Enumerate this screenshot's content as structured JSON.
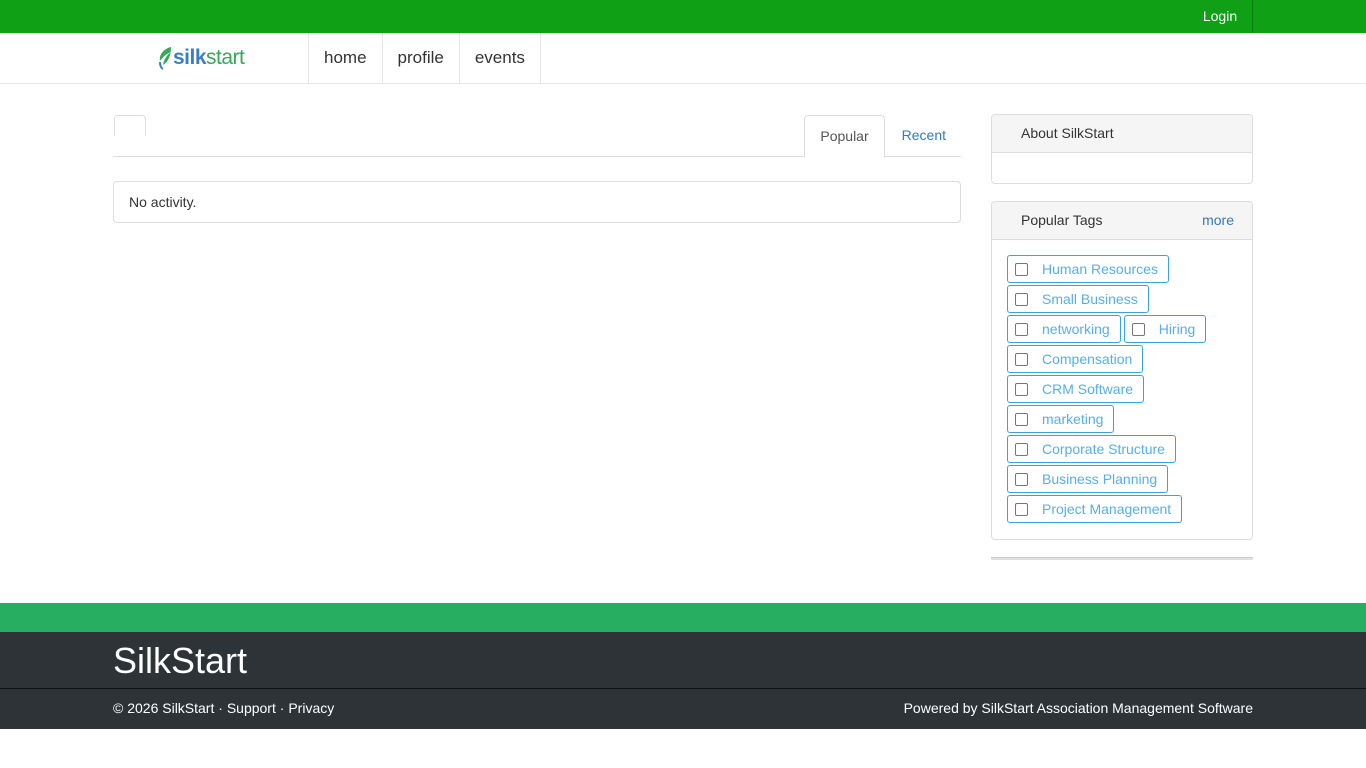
{
  "topbar": {
    "login_label": "Login"
  },
  "logo": {
    "silk": "silk",
    "start": "start"
  },
  "nav": {
    "items": [
      {
        "label": "home"
      },
      {
        "label": "profile"
      },
      {
        "label": "events"
      }
    ]
  },
  "main": {
    "tabs": [
      {
        "label": "Popular",
        "active": true
      },
      {
        "label": "Recent",
        "active": false
      }
    ],
    "empty_message": "No activity."
  },
  "sidebar": {
    "about_title": "About SilkStart",
    "tags_title": "Popular Tags",
    "more_label": "more",
    "tag_rows": [
      [
        "Human Resources"
      ],
      [
        "Small Business"
      ],
      [
        "networking",
        "Hiring"
      ],
      [
        "Compensation"
      ],
      [
        "CRM Software"
      ],
      [
        "marketing"
      ],
      [
        "Corporate Structure"
      ],
      [
        "Business Planning"
      ],
      [
        "Project Management"
      ]
    ]
  },
  "footer": {
    "title": "SilkStart",
    "copyright": "© 2026 SilkStart",
    "separator": " · ",
    "support_label": "Support",
    "privacy_label": "Privacy",
    "powered_by": "Powered by SilkStart Association Management Software"
  },
  "colors": {
    "topbar_green": "#0fa015",
    "band_green": "#27ae60",
    "footer_dark": "#2d3337",
    "link_blue": "#337ab7",
    "tag_blue": "#3aa2dc"
  }
}
